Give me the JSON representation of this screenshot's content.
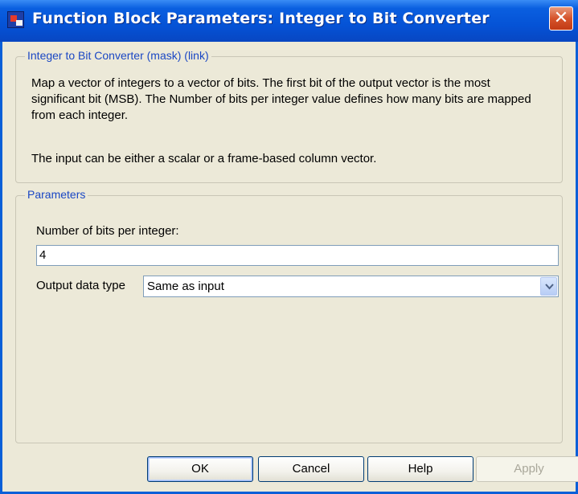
{
  "window": {
    "title": "Function Block Parameters: Integer to Bit Converter",
    "close_glyph": "✕"
  },
  "description_group": {
    "legend": "Integer to Bit Converter (mask) (link)",
    "paragraph1": "Map a vector of integers to a vector of bits. The first bit of the output vector is the most significant bit (MSB). The Number of bits per integer value defines how many bits are mapped from each integer.",
    "paragraph2": "The input can be either a scalar or a frame-based column vector."
  },
  "parameters_group": {
    "legend": "Parameters",
    "bits_label": "Number of bits per integer:",
    "bits_value": "4",
    "output_type_label": "Output data type",
    "output_type_selected": "Same as input"
  },
  "buttons": {
    "ok": "OK",
    "cancel": "Cancel",
    "help": "Help",
    "apply": "Apply"
  },
  "colors": {
    "titlebar": "#0553d6",
    "legend_text": "#1a47c4",
    "dialog_bg": "#ece9d8"
  }
}
